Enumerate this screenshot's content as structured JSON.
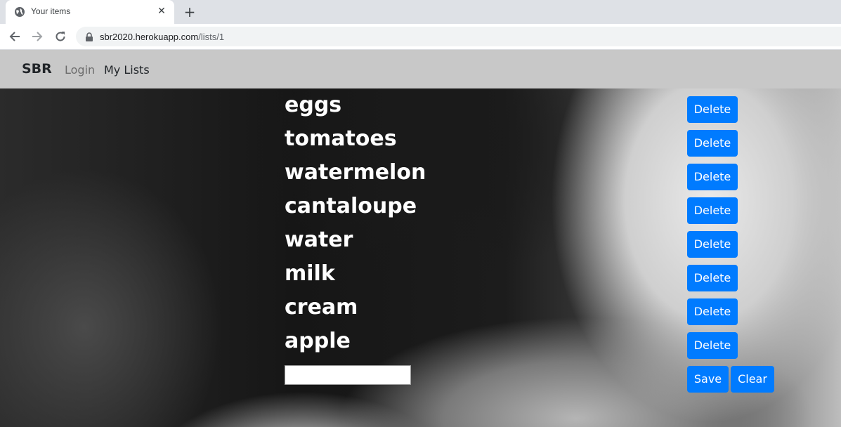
{
  "browser": {
    "tab_title": "Your items",
    "url_host": "sbr2020.herokuapp.com",
    "url_path": "/lists/1",
    "icons": {
      "favicon": "globe-icon",
      "close": "close-icon",
      "new_tab": "plus-icon",
      "back": "arrow-left-icon",
      "forward": "arrow-right-icon",
      "reload": "reload-icon",
      "lock": "lock-icon"
    }
  },
  "navbar": {
    "brand": "SBR",
    "links": [
      {
        "label": "Login"
      },
      {
        "label": "My Lists"
      }
    ]
  },
  "list": {
    "items": [
      {
        "label": "eggs",
        "action": "Delete"
      },
      {
        "label": "tomatoes",
        "action": "Delete"
      },
      {
        "label": "watermelon",
        "action": "Delete"
      },
      {
        "label": "cantaloupe",
        "action": "Delete"
      },
      {
        "label": "water",
        "action": "Delete"
      },
      {
        "label": "milk",
        "action": "Delete"
      },
      {
        "label": "cream",
        "action": "Delete"
      },
      {
        "label": "apple",
        "action": "Delete"
      }
    ],
    "new_item_value": "",
    "save_label": "Save",
    "clear_label": "Clear"
  },
  "colors": {
    "primary_button": "#007bff",
    "navbar_bg": "#c8c8c8",
    "text_on_dark": "#ffffff"
  }
}
